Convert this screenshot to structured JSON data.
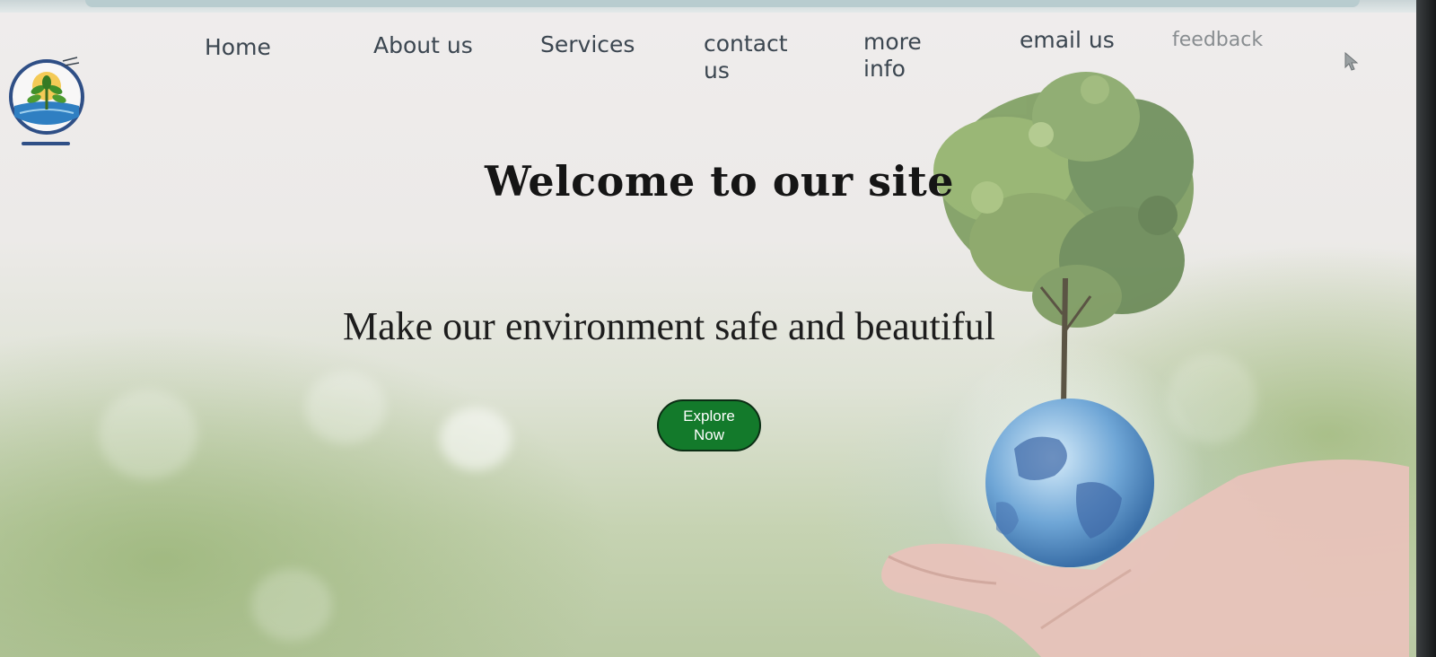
{
  "nav": {
    "items": [
      {
        "id": "home",
        "label": "Home"
      },
      {
        "id": "about",
        "label": "About us"
      },
      {
        "id": "services",
        "label": "Services"
      },
      {
        "id": "contact",
        "label": "contact us"
      },
      {
        "id": "more",
        "label": "more info"
      },
      {
        "id": "email",
        "label": "email us"
      },
      {
        "id": "feedback",
        "label": "feedback"
      }
    ]
  },
  "hero": {
    "title": "Welcome to our site",
    "subtitle": "Make our environment safe and beautiful",
    "cta_label": "Explore Now"
  },
  "colors": {
    "cta_background": "#137a2b",
    "logo_ring": "#2f4f86",
    "nav_text": "#3b4650"
  },
  "icons": {
    "logo": "tree-logo-icon",
    "cursor": "mouse-cursor-icon",
    "hero_art": "tree-globe-hand-illustration"
  }
}
